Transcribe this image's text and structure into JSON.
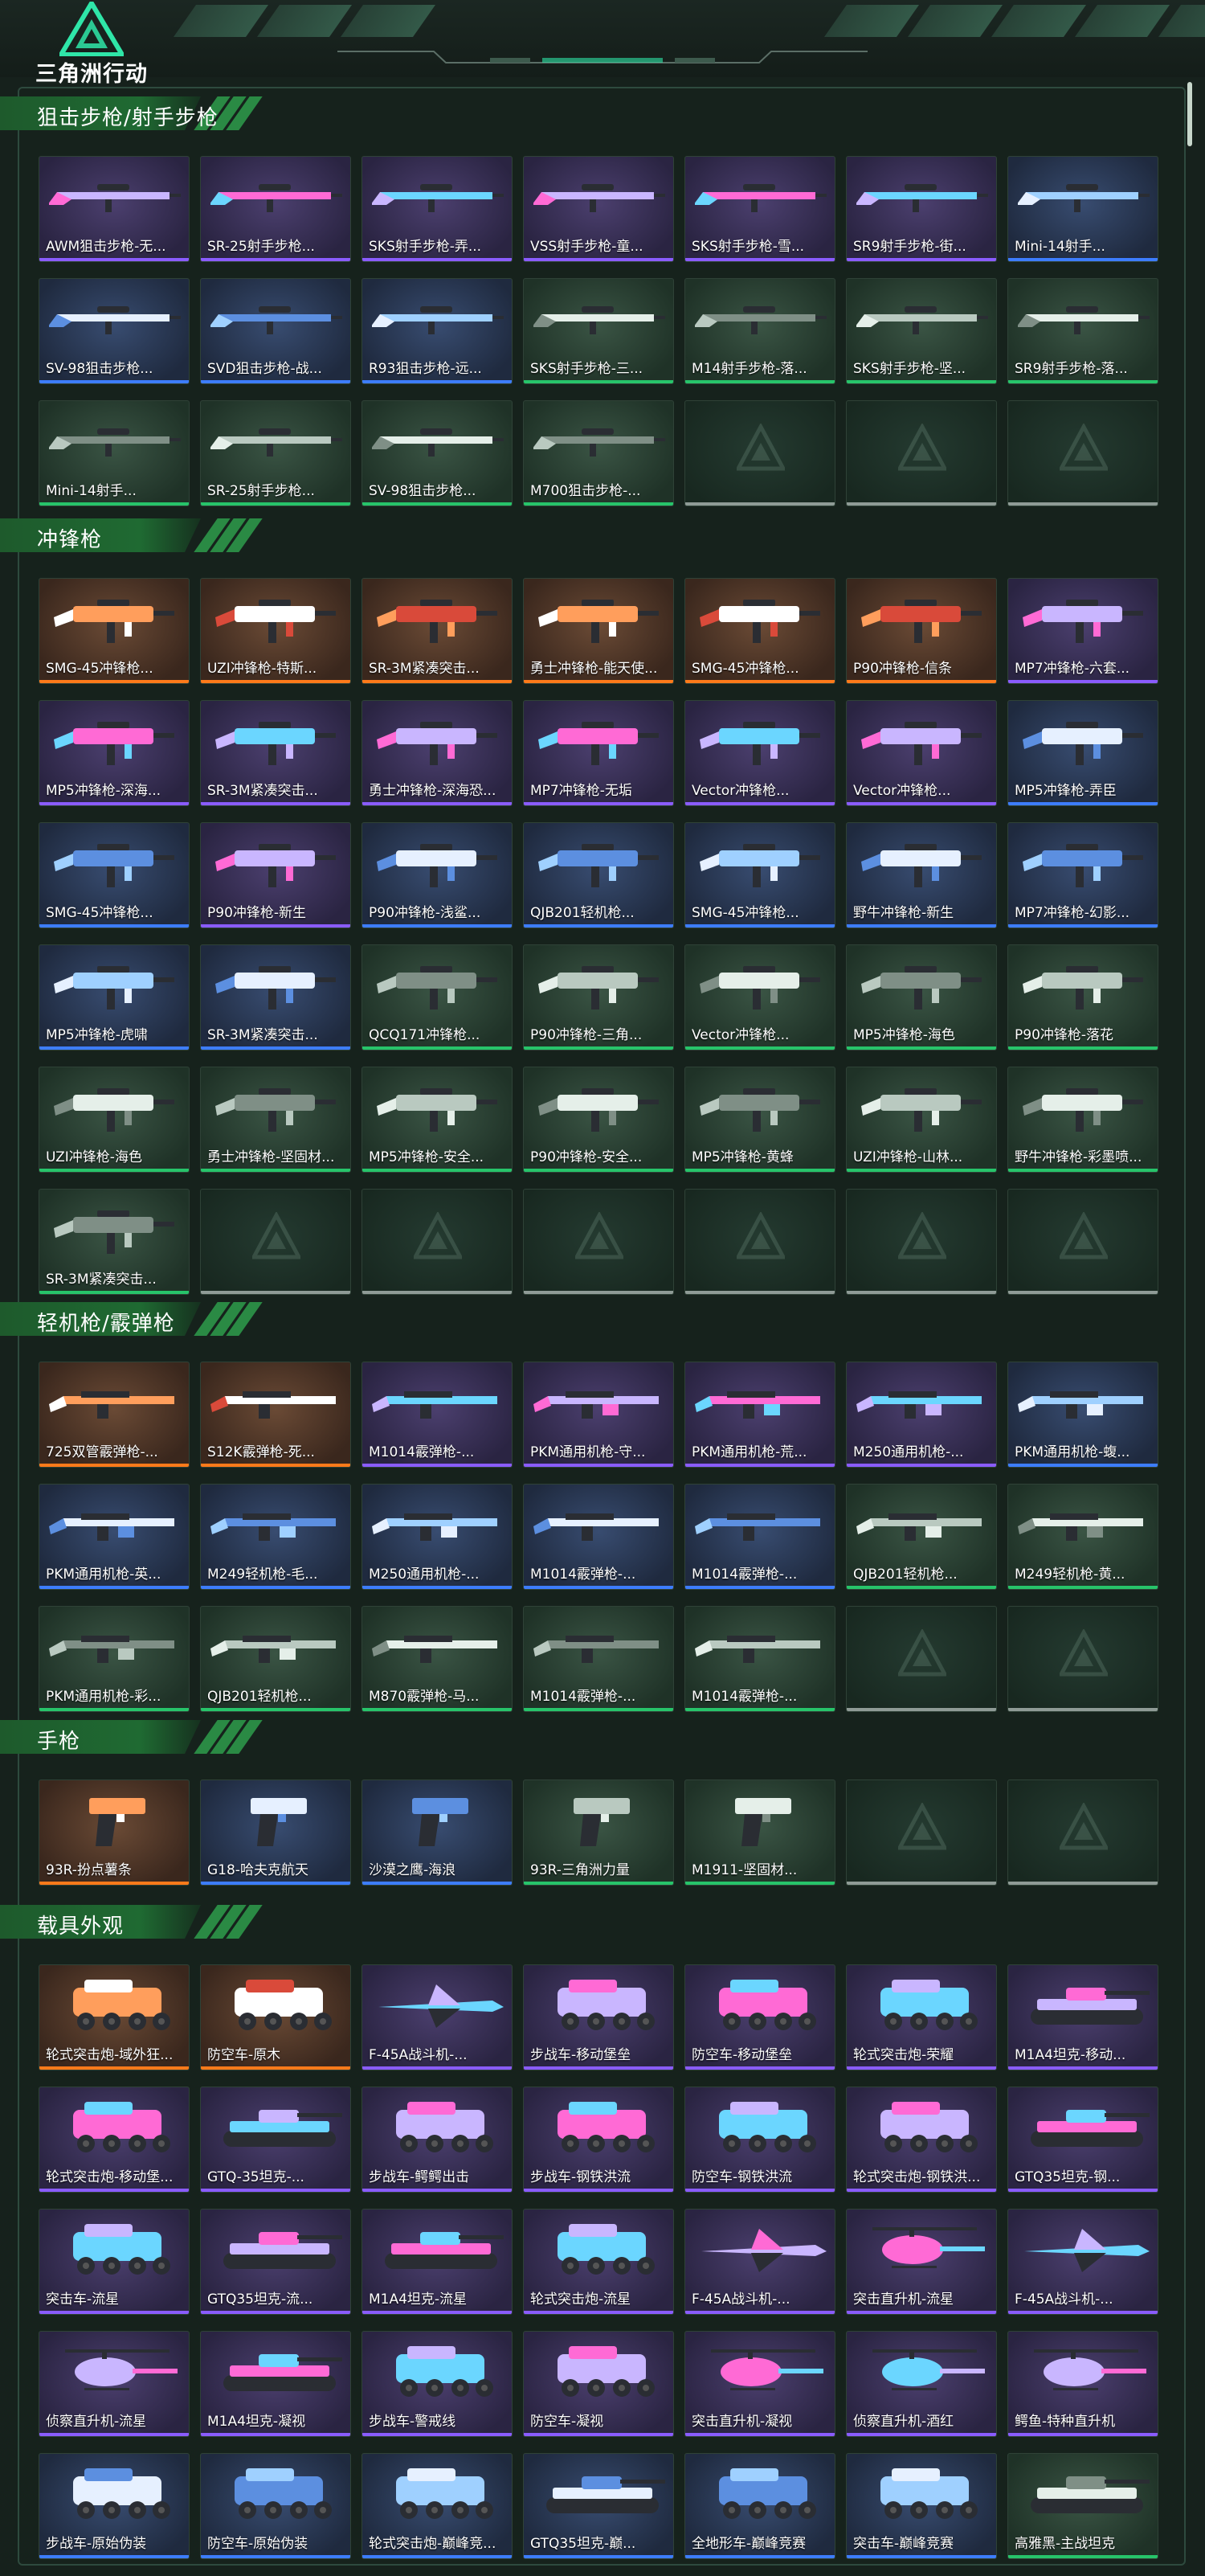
{
  "app": {
    "logo_text": "三角洲行动"
  },
  "colors": {
    "purple": "#8a5cff",
    "blue": "#3d7dff",
    "green": "#27c46a",
    "orange": "#ff7a1a",
    "empty": "#8f9b96",
    "section": "#1f6a32"
  },
  "sections": [
    {
      "title": "狙击步枪/射手步枪",
      "kind": "gun",
      "items": [
        {
          "label": "AWM狙击步枪-无...",
          "rarity": "purple",
          "icon": "sniper-rifle"
        },
        {
          "label": "SR-25射手步枪...",
          "rarity": "purple",
          "icon": "marksman-rifle"
        },
        {
          "label": "SKS射手步枪-弄...",
          "rarity": "purple",
          "icon": "marksman-rifle"
        },
        {
          "label": "VSS射手步枪-童...",
          "rarity": "purple",
          "icon": "marksman-rifle"
        },
        {
          "label": "SKS射手步枪-雪...",
          "rarity": "purple",
          "icon": "marksman-rifle"
        },
        {
          "label": "SR9射手步枪-街...",
          "rarity": "purple",
          "icon": "marksman-rifle"
        },
        {
          "label": "Mini-14射手...",
          "rarity": "blue",
          "icon": "marksman-rifle"
        },
        {
          "label": "SV-98狙击步枪...",
          "rarity": "blue",
          "icon": "sniper-rifle"
        },
        {
          "label": "SVD狙击步枪-战...",
          "rarity": "blue",
          "icon": "sniper-rifle"
        },
        {
          "label": "R93狙击步枪-远...",
          "rarity": "blue",
          "icon": "sniper-rifle"
        },
        {
          "label": "SKS射手步枪-三...",
          "rarity": "green",
          "icon": "marksman-rifle"
        },
        {
          "label": "M14射手步枪-落...",
          "rarity": "green",
          "icon": "marksman-rifle"
        },
        {
          "label": "SKS射手步枪-坚...",
          "rarity": "green",
          "icon": "marksman-rifle"
        },
        {
          "label": "SR9射手步枪-落...",
          "rarity": "green",
          "icon": "marksman-rifle"
        },
        {
          "label": "Mini-14射手...",
          "rarity": "green",
          "icon": "marksman-rifle"
        },
        {
          "label": "SR-25射手步枪...",
          "rarity": "green",
          "icon": "marksman-rifle"
        },
        {
          "label": "SV-98狙击步枪...",
          "rarity": "green",
          "icon": "sniper-rifle"
        },
        {
          "label": "M700狙击步枪-...",
          "rarity": "green",
          "icon": "sniper-rifle"
        },
        {
          "label": "",
          "rarity": "empty",
          "icon": "empty-slot"
        },
        {
          "label": "",
          "rarity": "empty",
          "icon": "empty-slot"
        },
        {
          "label": "",
          "rarity": "empty",
          "icon": "empty-slot"
        }
      ]
    },
    {
      "title": "冲锋枪",
      "kind": "gun",
      "items": [
        {
          "label": "SMG-45冲锋枪...",
          "rarity": "orange",
          "icon": "smg"
        },
        {
          "label": "UZI冲锋枪-特斯...",
          "rarity": "orange",
          "icon": "smg"
        },
        {
          "label": "SR-3M紧凑突击...",
          "rarity": "orange",
          "icon": "smg"
        },
        {
          "label": "勇士冲锋枪-能天使...",
          "rarity": "orange",
          "icon": "smg"
        },
        {
          "label": "SMG-45冲锋枪...",
          "rarity": "orange",
          "icon": "smg"
        },
        {
          "label": "P90冲锋枪-信条",
          "rarity": "orange",
          "icon": "smg"
        },
        {
          "label": "MP7冲锋枪-六套...",
          "rarity": "purple",
          "icon": "smg"
        },
        {
          "label": "MP5冲锋枪-深海...",
          "rarity": "purple",
          "icon": "smg"
        },
        {
          "label": "SR-3M紧凑突击...",
          "rarity": "purple",
          "icon": "smg"
        },
        {
          "label": "勇士冲锋枪-深海恐...",
          "rarity": "purple",
          "icon": "smg"
        },
        {
          "label": "MP7冲锋枪-无垢",
          "rarity": "purple",
          "icon": "smg"
        },
        {
          "label": "Vector冲锋枪...",
          "rarity": "purple",
          "icon": "smg"
        },
        {
          "label": "Vector冲锋枪...",
          "rarity": "purple",
          "icon": "smg"
        },
        {
          "label": "MP5冲锋枪-弄臣",
          "rarity": "blue",
          "icon": "smg"
        },
        {
          "label": "SMG-45冲锋枪...",
          "rarity": "blue",
          "icon": "smg"
        },
        {
          "label": "P90冲锋枪-新生",
          "rarity": "purple",
          "icon": "smg"
        },
        {
          "label": "P90冲锋枪-浅鲨...",
          "rarity": "blue",
          "icon": "smg"
        },
        {
          "label": "QJB201轻机枪...",
          "rarity": "blue",
          "icon": "smg"
        },
        {
          "label": "SMG-45冲锋枪...",
          "rarity": "blue",
          "icon": "smg"
        },
        {
          "label": "野牛冲锋枪-新生",
          "rarity": "blue",
          "icon": "smg"
        },
        {
          "label": "MP7冲锋枪-幻影...",
          "rarity": "blue",
          "icon": "smg"
        },
        {
          "label": "MP5冲锋枪-虎啸",
          "rarity": "blue",
          "icon": "smg"
        },
        {
          "label": "SR-3M紧凑突击...",
          "rarity": "blue",
          "icon": "smg"
        },
        {
          "label": "QCQ171冲锋枪...",
          "rarity": "green",
          "icon": "smg"
        },
        {
          "label": "P90冲锋枪-三角...",
          "rarity": "green",
          "icon": "smg"
        },
        {
          "label": "Vector冲锋枪...",
          "rarity": "green",
          "icon": "smg"
        },
        {
          "label": "MP5冲锋枪-海色",
          "rarity": "green",
          "icon": "smg"
        },
        {
          "label": "P90冲锋枪-落花",
          "rarity": "green",
          "icon": "smg"
        },
        {
          "label": "UZI冲锋枪-海色",
          "rarity": "green",
          "icon": "smg"
        },
        {
          "label": "勇士冲锋枪-坚固材...",
          "rarity": "green",
          "icon": "smg"
        },
        {
          "label": "MP5冲锋枪-安全...",
          "rarity": "green",
          "icon": "smg"
        },
        {
          "label": "P90冲锋枪-安全...",
          "rarity": "green",
          "icon": "smg"
        },
        {
          "label": "MP5冲锋枪-黄蜂",
          "rarity": "green",
          "icon": "smg"
        },
        {
          "label": "UZI冲锋枪-山林...",
          "rarity": "green",
          "icon": "smg"
        },
        {
          "label": "野牛冲锋枪-彩墨喷...",
          "rarity": "green",
          "icon": "smg"
        },
        {
          "label": "SR-3M紧凑突击...",
          "rarity": "green",
          "icon": "smg"
        },
        {
          "label": "",
          "rarity": "empty",
          "icon": "empty-slot"
        },
        {
          "label": "",
          "rarity": "empty",
          "icon": "empty-slot"
        },
        {
          "label": "",
          "rarity": "empty",
          "icon": "empty-slot"
        },
        {
          "label": "",
          "rarity": "empty",
          "icon": "empty-slot"
        },
        {
          "label": "",
          "rarity": "empty",
          "icon": "empty-slot"
        },
        {
          "label": "",
          "rarity": "empty",
          "icon": "empty-slot"
        }
      ]
    },
    {
      "title": "轻机枪/霰弹枪",
      "kind": "gun",
      "items": [
        {
          "label": "725双管霰弹枪-...",
          "rarity": "orange",
          "icon": "shotgun"
        },
        {
          "label": "S12K霰弹枪-死...",
          "rarity": "orange",
          "icon": "shotgun"
        },
        {
          "label": "M1014霰弹枪-...",
          "rarity": "purple",
          "icon": "shotgun"
        },
        {
          "label": "PKM通用机枪-守...",
          "rarity": "purple",
          "icon": "machine-gun"
        },
        {
          "label": "PKM通用机枪-荒...",
          "rarity": "purple",
          "icon": "machine-gun"
        },
        {
          "label": "M250通用机枪-...",
          "rarity": "purple",
          "icon": "machine-gun"
        },
        {
          "label": "PKM通用机枪-蝮...",
          "rarity": "blue",
          "icon": "machine-gun"
        },
        {
          "label": "PKM通用机枪-英...",
          "rarity": "blue",
          "icon": "machine-gun"
        },
        {
          "label": "M249轻机枪-毛...",
          "rarity": "blue",
          "icon": "machine-gun"
        },
        {
          "label": "M250通用机枪-...",
          "rarity": "blue",
          "icon": "machine-gun"
        },
        {
          "label": "M1014霰弹枪-...",
          "rarity": "blue",
          "icon": "shotgun"
        },
        {
          "label": "M1014霰弹枪-...",
          "rarity": "blue",
          "icon": "shotgun"
        },
        {
          "label": "QJB201轻机枪...",
          "rarity": "green",
          "icon": "machine-gun"
        },
        {
          "label": "M249轻机枪-黄...",
          "rarity": "green",
          "icon": "machine-gun"
        },
        {
          "label": "PKM通用机枪-彩...",
          "rarity": "green",
          "icon": "machine-gun"
        },
        {
          "label": "QJB201轻机枪...",
          "rarity": "green",
          "icon": "machine-gun"
        },
        {
          "label": "M870霰弹枪-马...",
          "rarity": "green",
          "icon": "shotgun"
        },
        {
          "label": "M1014霰弹枪-...",
          "rarity": "green",
          "icon": "shotgun"
        },
        {
          "label": "M1014霰弹枪-...",
          "rarity": "green",
          "icon": "shotgun"
        },
        {
          "label": "",
          "rarity": "empty",
          "icon": "empty-slot"
        },
        {
          "label": "",
          "rarity": "empty",
          "icon": "empty-slot"
        }
      ]
    },
    {
      "title": "手枪",
      "kind": "pistol",
      "items": [
        {
          "label": "93R-扮点薯条",
          "rarity": "orange",
          "icon": "pistol"
        },
        {
          "label": "G18-哈夫克航天",
          "rarity": "blue",
          "icon": "pistol"
        },
        {
          "label": "沙漠之鹰-海浪",
          "rarity": "blue",
          "icon": "pistol"
        },
        {
          "label": "93R-三角洲力量",
          "rarity": "green",
          "icon": "pistol"
        },
        {
          "label": "M1911-坚固材...",
          "rarity": "green",
          "icon": "pistol"
        },
        {
          "label": "",
          "rarity": "empty",
          "icon": "empty-slot"
        },
        {
          "label": "",
          "rarity": "empty",
          "icon": "empty-slot"
        }
      ]
    },
    {
      "title": "载具外观",
      "kind": "vehicle",
      "items": [
        {
          "label": "轮式突击炮-域外狂...",
          "rarity": "orange",
          "icon": "vehicle"
        },
        {
          "label": "防空车-原木",
          "rarity": "orange",
          "icon": "vehicle"
        },
        {
          "label": "F-45A战斗机-...",
          "rarity": "purple",
          "icon": "jet"
        },
        {
          "label": "步战车-移动堡垒",
          "rarity": "purple",
          "icon": "vehicle"
        },
        {
          "label": "防空车-移动堡垒",
          "rarity": "purple",
          "icon": "vehicle"
        },
        {
          "label": "轮式突击炮-荣耀",
          "rarity": "purple",
          "icon": "vehicle"
        },
        {
          "label": "M1A4坦克-移动...",
          "rarity": "purple",
          "icon": "tank"
        },
        {
          "label": "轮式突击炮-移动堡...",
          "rarity": "purple",
          "icon": "vehicle"
        },
        {
          "label": "GTQ-35坦克-...",
          "rarity": "purple",
          "icon": "tank"
        },
        {
          "label": "步战车-鳄鳄出击",
          "rarity": "purple",
          "icon": "vehicle"
        },
        {
          "label": "步战车-钢铁洪流",
          "rarity": "purple",
          "icon": "vehicle"
        },
        {
          "label": "防空车-钢铁洪流",
          "rarity": "purple",
          "icon": "vehicle"
        },
        {
          "label": "轮式突击炮-钢铁洪...",
          "rarity": "purple",
          "icon": "vehicle"
        },
        {
          "label": "GTQ35坦克-钢...",
          "rarity": "purple",
          "icon": "tank"
        },
        {
          "label": "突击车-流星",
          "rarity": "purple",
          "icon": "vehicle"
        },
        {
          "label": "GTQ35坦克-流...",
          "rarity": "purple",
          "icon": "tank"
        },
        {
          "label": "M1A4坦克-流星",
          "rarity": "purple",
          "icon": "tank"
        },
        {
          "label": "轮式突击炮-流星",
          "rarity": "purple",
          "icon": "vehicle"
        },
        {
          "label": "F-45A战斗机-...",
          "rarity": "purple",
          "icon": "jet"
        },
        {
          "label": "突击直升机-流星",
          "rarity": "purple",
          "icon": "helicopter"
        },
        {
          "label": "F-45A战斗机-...",
          "rarity": "purple",
          "icon": "jet"
        },
        {
          "label": "侦察直升机-流星",
          "rarity": "purple",
          "icon": "helicopter"
        },
        {
          "label": "M1A4坦克-凝视",
          "rarity": "purple",
          "icon": "tank"
        },
        {
          "label": "步战车-警戒线",
          "rarity": "purple",
          "icon": "vehicle"
        },
        {
          "label": "防空车-凝视",
          "rarity": "purple",
          "icon": "vehicle"
        },
        {
          "label": "突击直升机-凝视",
          "rarity": "purple",
          "icon": "helicopter"
        },
        {
          "label": "侦察直升机-酒红",
          "rarity": "purple",
          "icon": "helicopter"
        },
        {
          "label": "鳄鱼-特种直升机",
          "rarity": "purple",
          "icon": "helicopter"
        },
        {
          "label": "步战车-原始伪装",
          "rarity": "blue",
          "icon": "vehicle"
        },
        {
          "label": "防空车-原始伪装",
          "rarity": "blue",
          "icon": "vehicle"
        },
        {
          "label": "轮式突击炮-巅峰竞...",
          "rarity": "blue",
          "icon": "vehicle"
        },
        {
          "label": "GTQ35坦克-巅...",
          "rarity": "blue",
          "icon": "tank"
        },
        {
          "label": "全地形车-巅峰竞赛",
          "rarity": "blue",
          "icon": "vehicle"
        },
        {
          "label": "突击车-巅峰竞赛",
          "rarity": "blue",
          "icon": "vehicle"
        },
        {
          "label": "高雅黑-主战坦克",
          "rarity": "green",
          "icon": "tank"
        }
      ]
    }
  ]
}
